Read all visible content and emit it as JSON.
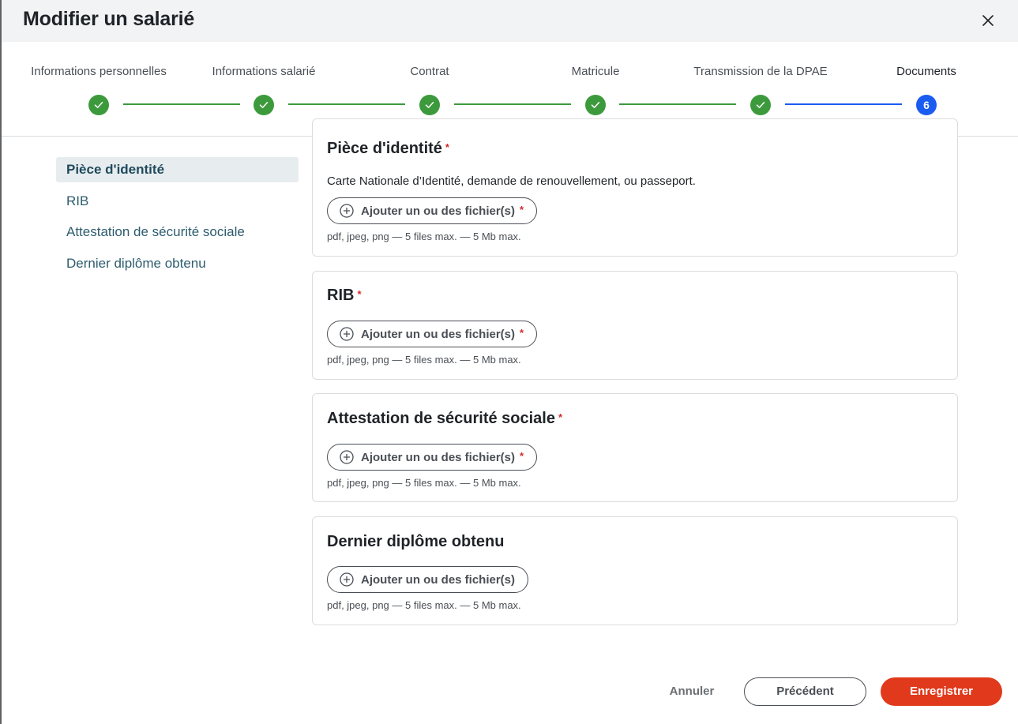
{
  "modal": {
    "title": "Modifier un salarié"
  },
  "colors": {
    "done": "#3c9a3c",
    "current": "#1a5cf0",
    "primary_button": "#e0391b",
    "required": "#d42a2a"
  },
  "stepper": {
    "steps": [
      {
        "label": "Informations personnelles",
        "state": "done"
      },
      {
        "label": "Informations salarié",
        "state": "done"
      },
      {
        "label": "Contrat",
        "state": "done"
      },
      {
        "label": "Matricule",
        "state": "done"
      },
      {
        "label": "Transmission de la DPAE",
        "state": "done"
      },
      {
        "label": "Documents",
        "state": "current",
        "number": "6"
      }
    ]
  },
  "sidebar": {
    "items": [
      {
        "label": "Pièce d'identité",
        "active": true
      },
      {
        "label": "RIB",
        "active": false
      },
      {
        "label": "Attestation de sécurité sociale",
        "active": false
      },
      {
        "label": "Dernier diplôme obtenu",
        "active": false
      }
    ]
  },
  "documents": [
    {
      "title": "Pièce d'identité",
      "required_mark": "*",
      "description": "Carte Nationale d’Identité, demande de renouvellement, ou passeport.",
      "button_label": "Ajouter un ou des fichier(s)",
      "button_required_mark": "*",
      "hint": "pdf, jpeg, png — 5 files max. — 5 Mb max."
    },
    {
      "title": "RIB",
      "required_mark": "*",
      "button_label": "Ajouter un ou des fichier(s)",
      "button_required_mark": "*",
      "hint": "pdf, jpeg, png — 5 files max. — 5 Mb max."
    },
    {
      "title": "Attestation de sécurité sociale",
      "required_mark": "*",
      "button_label": "Ajouter un ou des fichier(s)",
      "button_required_mark": "*",
      "hint": "pdf, jpeg, png — 5 files max. — 5 Mb max."
    },
    {
      "title": "Dernier diplôme obtenu",
      "button_label": "Ajouter un ou des fichier(s)",
      "hint": "pdf, jpeg, png — 5 files max. — 5 Mb max."
    }
  ],
  "footer": {
    "cancel_label": "Annuler",
    "previous_label": "Précédent",
    "save_label": "Enregistrer"
  },
  "icons": {
    "close": "close-icon",
    "check": "check-icon",
    "add_file": "plus-circle-icon"
  }
}
